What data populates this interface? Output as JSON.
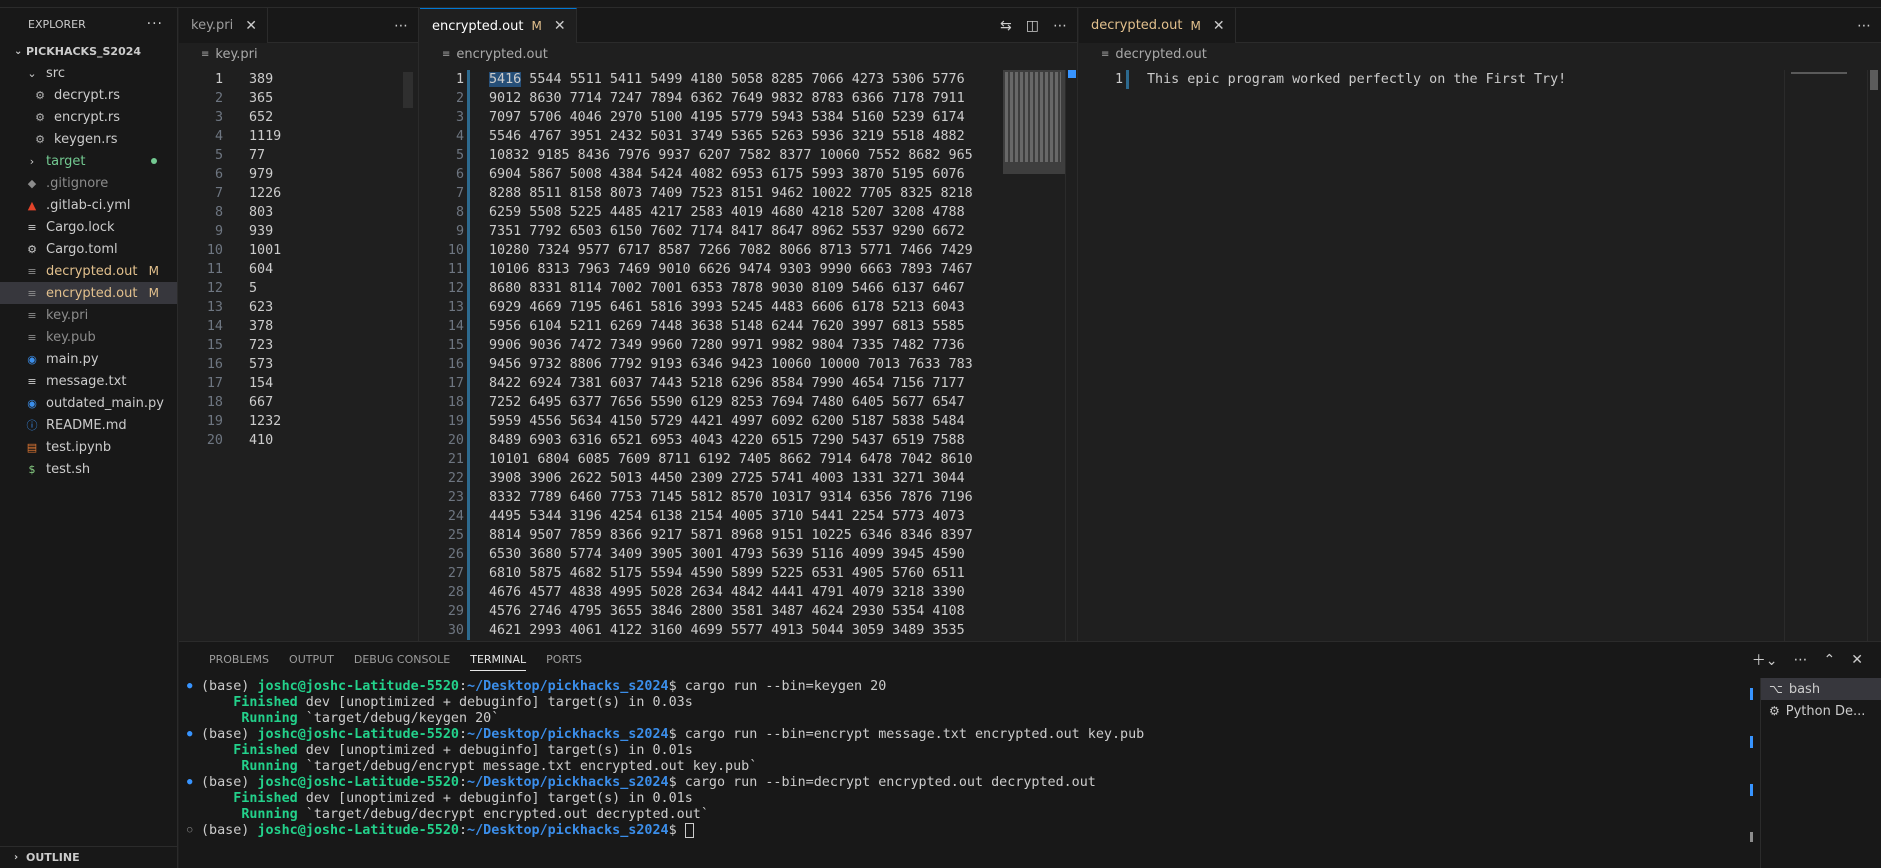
{
  "sidebar": {
    "title": "EXPLORER",
    "more": "···",
    "root": "PICKHACKS_S2024",
    "items": [
      {
        "label": "src",
        "kind": "folder-open",
        "indent": 1
      },
      {
        "label": "decrypt.rs",
        "kind": "rust",
        "indent": 2
      },
      {
        "label": "encrypt.rs",
        "kind": "rust",
        "indent": 2
      },
      {
        "label": "keygen.rs",
        "kind": "rust",
        "indent": 2
      },
      {
        "label": "target",
        "kind": "folder",
        "indent": 1
      },
      {
        "label": ".gitignore",
        "kind": "git",
        "indent": 1
      },
      {
        "label": ".gitlab-ci.yml",
        "kind": "gitlab",
        "indent": 1
      },
      {
        "label": "Cargo.lock",
        "kind": "lock",
        "indent": 1
      },
      {
        "label": "Cargo.toml",
        "kind": "gear",
        "indent": 1
      },
      {
        "label": "decrypted.out",
        "kind": "file",
        "indent": 1,
        "badge": "M"
      },
      {
        "label": "encrypted.out",
        "kind": "file",
        "indent": 1,
        "badge": "M"
      },
      {
        "label": "key.pri",
        "kind": "file",
        "indent": 1
      },
      {
        "label": "key.pub",
        "kind": "file",
        "indent": 1
      },
      {
        "label": "main.py",
        "kind": "python",
        "indent": 1
      },
      {
        "label": "message.txt",
        "kind": "text",
        "indent": 1
      },
      {
        "label": "outdated_main.py",
        "kind": "python",
        "indent": 1
      },
      {
        "label": "README.md",
        "kind": "info",
        "indent": 1
      },
      {
        "label": "test.ipynb",
        "kind": "notebook",
        "indent": 1
      },
      {
        "label": "test.sh",
        "kind": "shell",
        "indent": 1
      }
    ],
    "outline": "OUTLINE"
  },
  "editor1": {
    "tab": "key.pri",
    "breadcrumb": "key.pri",
    "lines": [
      "389",
      "365",
      "652",
      "1119",
      "77",
      "979",
      "1226",
      "803",
      "939",
      "1001",
      "604",
      "5",
      "623",
      "378",
      "723",
      "573",
      "154",
      "667",
      "1232",
      "410"
    ]
  },
  "editor2": {
    "tab": "encrypted.out",
    "tab_badge": "M",
    "breadcrumb": "encrypted.out",
    "lines": [
      "5416 5544 5511 5411 5499 4180 5058 8285 7066 4273 5306 5776",
      "9012 8630 7714 7247 7894 6362 7649 9832 8783 6366 7178 7911",
      "7097 5706 4046 2970 5100 4195 5779 5943 5384 5160 5239 6174",
      "5546 4767 3951 2432 5031 3749 5365 5263 5936 3219 5518 4882",
      "10832 9185 8436 7976 9937 6207 7582 8377 10060 7552 8682 965",
      "6904 5867 5008 4384 5424 4082 6953 6175 5993 3870 5195 6076",
      "8288 8511 8158 8073 7409 7523 8151 9462 10022 7705 8325 8218",
      "6259 5508 5225 4485 4217 2583 4019 4680 4218 5207 3208 4788",
      "7351 7792 6503 6150 7602 7174 8417 8647 8962 5537 9290 6672",
      "10280 7324 9577 6717 8587 7266 7082 8066 8713 5771 7466 7429",
      "10106 8313 7963 7469 9010 6626 9474 9303 9990 6663 7893 7467",
      "8680 8331 8114 7002 7001 6353 7878 9030 8109 5466 6137 6467",
      "6929 4669 7195 6461 5816 3993 5245 4483 6606 6178 5213 6043",
      "5956 6104 5211 6269 7448 3638 5148 6244 7620 3997 6813 5585",
      "9906 9036 7472 7349 9960 7280 9971 9982 9804 7335 7482 7736",
      "9456 9732 8806 7792 9193 6346 9423 10060 10000 7013 7633 783",
      "8422 6924 7381 6037 7443 5218 6296 8584 7990 4654 7156 7177",
      "7252 6495 6377 7656 5590 6129 8253 7694 7480 6405 5677 6547",
      "5959 4556 5634 4150 5729 4421 4997 6092 6200 5187 5838 5484",
      "8489 6903 6316 6521 6953 4043 4220 6515 7290 5437 6519 7588",
      "10101 6804 6085 7609 8711 6192 7405 8662 7914 6478 7042 8610",
      "3908 3906 2622 5013 4450 2309 2725 5741 4003 1331 3271 3044",
      "8332 7789 6460 7753 7145 5812 8570 10317 9314 6356 7876 7196",
      "4495 5344 3196 4254 6138 2154 4005 3710 5441 2254 5773 4073",
      "8814 9507 7859 8366 9217 5871 8968 9151 10225 6346 8346 8397",
      "6530 3680 5774 3409 3905 3001 4793 5639 5116 4099 3945 4590",
      "6810 5875 4682 5175 5594 4590 5899 5225 6531 4905 5760 6511",
      "4676 4577 4838 4995 5028 2634 4842 4441 4791 4079 3218 3390",
      "4576 2746 4795 3655 3846 2800 3581 3487 4624 2930 5354 4108",
      "4621 2993 4061 4122 3160 4699 5577 4913 5044 3059 3489 3535"
    ]
  },
  "editor3": {
    "tab": "decrypted.out",
    "tab_badge": "M",
    "breadcrumb": "decrypted.out",
    "lines": [
      "This epic program worked perfectly on the First Try!"
    ]
  },
  "panel": {
    "tabs": [
      "PROBLEMS",
      "OUTPUT",
      "DEBUG CONSOLE",
      "TERMINAL",
      "PORTS"
    ],
    "active_tab": "TERMINAL",
    "terminals": [
      "bash",
      "Python De..."
    ],
    "prompt_env": "(base)",
    "prompt_user": "joshc@joshc-Latitude-5520",
    "prompt_path": "~/Desktop/pickhacks_s2024",
    "cmd1": "cargo run --bin=keygen 20",
    "cmd2": "cargo run --bin=encrypt message.txt encrypted.out key.pub",
    "cmd3": "cargo run --bin=decrypt encrypted.out decrypted.out",
    "finished_word": "Finished",
    "running_word": "Running",
    "out1a": " dev [unoptimized + debuginfo] target(s) in 0.03s",
    "out1b": " `target/debug/keygen 20`",
    "out2a": " dev [unoptimized + debuginfo] target(s) in 0.01s",
    "out2b": " `target/debug/encrypt message.txt encrypted.out key.pub`",
    "out3a": " dev [unoptimized + debuginfo] target(s) in 0.01s",
    "out3b": " `target/debug/decrypt encrypted.out decrypted.out`"
  }
}
